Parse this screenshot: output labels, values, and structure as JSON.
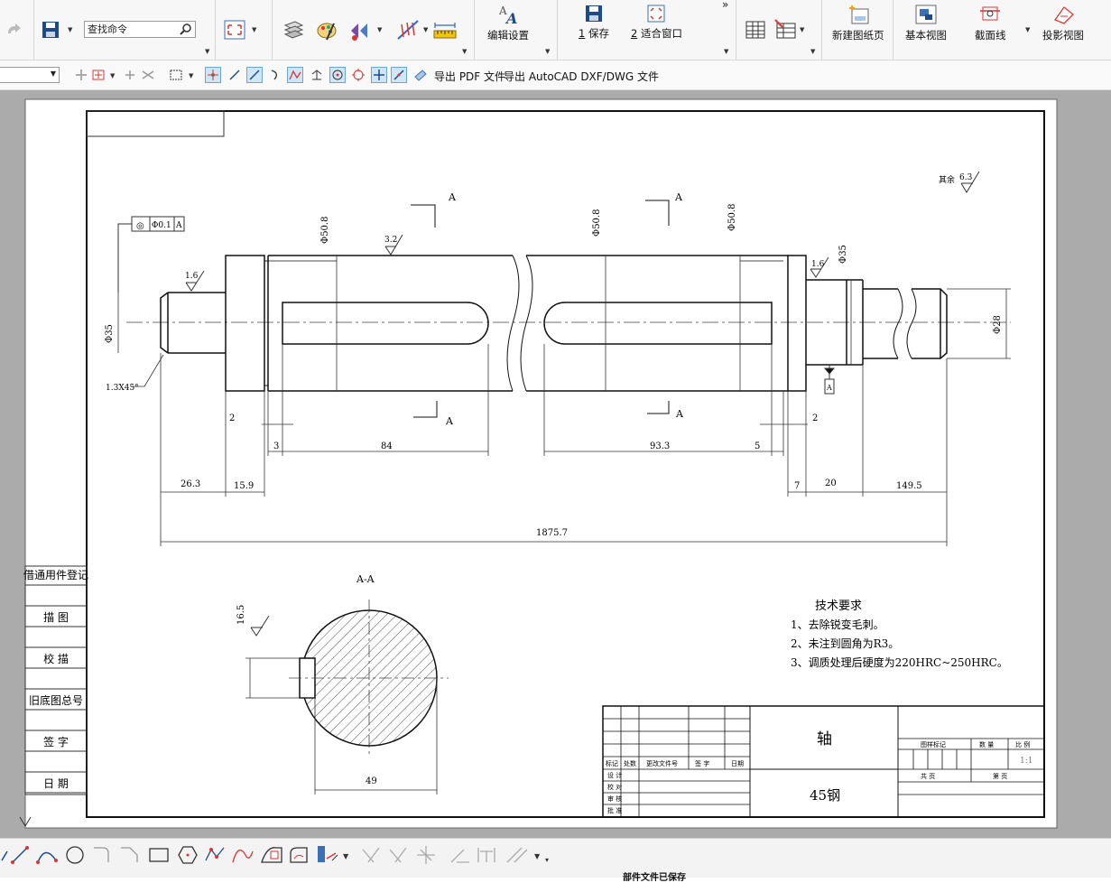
{
  "ribbon": {
    "search_placeholder": "查找命令",
    "edit_settings": "编辑设置",
    "save": "保存",
    "save_hotkey": "1",
    "fit_window": "适合窗口",
    "fit_hotkey": "2",
    "new_sheet": "新建图纸页",
    "base_view": "基本视图",
    "section_line": "截面线",
    "projected_view": "投影视图",
    "overflow": "»"
  },
  "snap_toolbar": {
    "export_pdf": "导出 PDF 文件",
    "export_dxf": "导出 AutoCAD DXF/DWG 文件"
  },
  "drawing": {
    "left_strip": [
      "借通用件登记",
      "描  图",
      "校  描",
      "旧底图总号",
      "签  字",
      "日  期"
    ],
    "fcf": {
      "symbol": "◎",
      "tolerance": "Φ0.1",
      "datum": "A"
    },
    "roughness_other": "其余",
    "roughness_other_value": "6.3",
    "roughness_values": [
      "3.2",
      "1.6",
      "1.6"
    ],
    "section_marker": "A",
    "section_title": "A-A",
    "diameters": [
      "Φ50.8",
      "Φ50.8",
      "Φ50.8",
      "Φ35",
      "Φ35",
      "Φ28"
    ],
    "chamfer": "1.3X45°",
    "dims_small": [
      "2",
      "2",
      "3",
      "5",
      "7"
    ],
    "dims": {
      "d84": "84",
      "d93_3": "93.3",
      "d26_3": "26.3",
      "d15_9": "15.9",
      "d20": "20",
      "d149_5": "149.5",
      "total": "1875.7",
      "keyway_depth": "16.5",
      "keyway_width": "49"
    },
    "tech_title": "技术要求",
    "tech_lines": [
      "1、去除锐变毛刺。",
      "2、未注到圆角为R3。",
      "3、调质处理后硬度为220HRC~250HRC。"
    ],
    "title_block": {
      "part_name": "轴",
      "material": "45钢",
      "hdr": [
        "标记",
        "处数",
        "更改文件号",
        "签  字",
        "日期"
      ],
      "roles": [
        "设 计",
        "校 对",
        "审 核",
        "批 准"
      ],
      "stage_mark": "图样标记",
      "weight": "数  量",
      "scale": "比  例",
      "scale_value": "1:1",
      "sheets": "共   页",
      "sheet": "第   页"
    }
  },
  "status_text": "部件文件已保存"
}
